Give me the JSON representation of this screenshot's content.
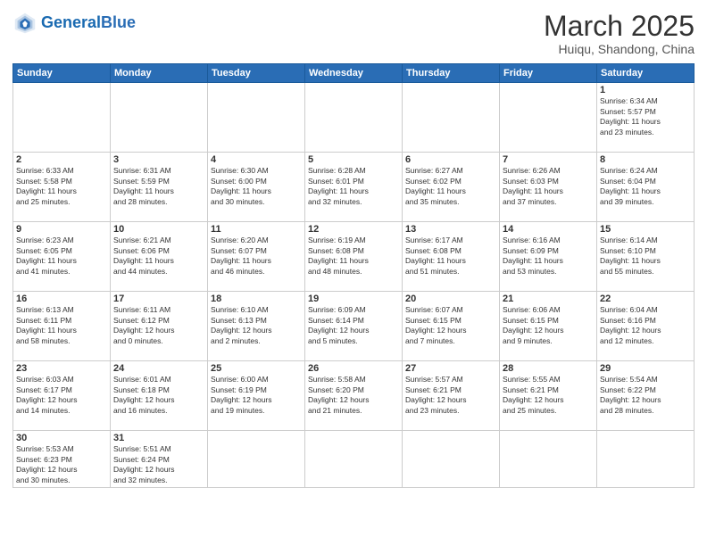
{
  "header": {
    "logo_general": "General",
    "logo_blue": "Blue",
    "month_title": "March 2025",
    "subtitle": "Huiqu, Shandong, China"
  },
  "days_of_week": [
    "Sunday",
    "Monday",
    "Tuesday",
    "Wednesday",
    "Thursday",
    "Friday",
    "Saturday"
  ],
  "weeks": [
    [
      {
        "num": "",
        "info": ""
      },
      {
        "num": "",
        "info": ""
      },
      {
        "num": "",
        "info": ""
      },
      {
        "num": "",
        "info": ""
      },
      {
        "num": "",
        "info": ""
      },
      {
        "num": "",
        "info": ""
      },
      {
        "num": "1",
        "info": "Sunrise: 6:34 AM\nSunset: 5:57 PM\nDaylight: 11 hours\nand 23 minutes."
      }
    ],
    [
      {
        "num": "2",
        "info": "Sunrise: 6:33 AM\nSunset: 5:58 PM\nDaylight: 11 hours\nand 25 minutes."
      },
      {
        "num": "3",
        "info": "Sunrise: 6:31 AM\nSunset: 5:59 PM\nDaylight: 11 hours\nand 28 minutes."
      },
      {
        "num": "4",
        "info": "Sunrise: 6:30 AM\nSunset: 6:00 PM\nDaylight: 11 hours\nand 30 minutes."
      },
      {
        "num": "5",
        "info": "Sunrise: 6:28 AM\nSunset: 6:01 PM\nDaylight: 11 hours\nand 32 minutes."
      },
      {
        "num": "6",
        "info": "Sunrise: 6:27 AM\nSunset: 6:02 PM\nDaylight: 11 hours\nand 35 minutes."
      },
      {
        "num": "7",
        "info": "Sunrise: 6:26 AM\nSunset: 6:03 PM\nDaylight: 11 hours\nand 37 minutes."
      },
      {
        "num": "8",
        "info": "Sunrise: 6:24 AM\nSunset: 6:04 PM\nDaylight: 11 hours\nand 39 minutes."
      }
    ],
    [
      {
        "num": "9",
        "info": "Sunrise: 6:23 AM\nSunset: 6:05 PM\nDaylight: 11 hours\nand 41 minutes."
      },
      {
        "num": "10",
        "info": "Sunrise: 6:21 AM\nSunset: 6:06 PM\nDaylight: 11 hours\nand 44 minutes."
      },
      {
        "num": "11",
        "info": "Sunrise: 6:20 AM\nSunset: 6:07 PM\nDaylight: 11 hours\nand 46 minutes."
      },
      {
        "num": "12",
        "info": "Sunrise: 6:19 AM\nSunset: 6:08 PM\nDaylight: 11 hours\nand 48 minutes."
      },
      {
        "num": "13",
        "info": "Sunrise: 6:17 AM\nSunset: 6:08 PM\nDaylight: 11 hours\nand 51 minutes."
      },
      {
        "num": "14",
        "info": "Sunrise: 6:16 AM\nSunset: 6:09 PM\nDaylight: 11 hours\nand 53 minutes."
      },
      {
        "num": "15",
        "info": "Sunrise: 6:14 AM\nSunset: 6:10 PM\nDaylight: 11 hours\nand 55 minutes."
      }
    ],
    [
      {
        "num": "16",
        "info": "Sunrise: 6:13 AM\nSunset: 6:11 PM\nDaylight: 11 hours\nand 58 minutes."
      },
      {
        "num": "17",
        "info": "Sunrise: 6:11 AM\nSunset: 6:12 PM\nDaylight: 12 hours\nand 0 minutes."
      },
      {
        "num": "18",
        "info": "Sunrise: 6:10 AM\nSunset: 6:13 PM\nDaylight: 12 hours\nand 2 minutes."
      },
      {
        "num": "19",
        "info": "Sunrise: 6:09 AM\nSunset: 6:14 PM\nDaylight: 12 hours\nand 5 minutes."
      },
      {
        "num": "20",
        "info": "Sunrise: 6:07 AM\nSunset: 6:15 PM\nDaylight: 12 hours\nand 7 minutes."
      },
      {
        "num": "21",
        "info": "Sunrise: 6:06 AM\nSunset: 6:15 PM\nDaylight: 12 hours\nand 9 minutes."
      },
      {
        "num": "22",
        "info": "Sunrise: 6:04 AM\nSunset: 6:16 PM\nDaylight: 12 hours\nand 12 minutes."
      }
    ],
    [
      {
        "num": "23",
        "info": "Sunrise: 6:03 AM\nSunset: 6:17 PM\nDaylight: 12 hours\nand 14 minutes."
      },
      {
        "num": "24",
        "info": "Sunrise: 6:01 AM\nSunset: 6:18 PM\nDaylight: 12 hours\nand 16 minutes."
      },
      {
        "num": "25",
        "info": "Sunrise: 6:00 AM\nSunset: 6:19 PM\nDaylight: 12 hours\nand 19 minutes."
      },
      {
        "num": "26",
        "info": "Sunrise: 5:58 AM\nSunset: 6:20 PM\nDaylight: 12 hours\nand 21 minutes."
      },
      {
        "num": "27",
        "info": "Sunrise: 5:57 AM\nSunset: 6:21 PM\nDaylight: 12 hours\nand 23 minutes."
      },
      {
        "num": "28",
        "info": "Sunrise: 5:55 AM\nSunset: 6:21 PM\nDaylight: 12 hours\nand 25 minutes."
      },
      {
        "num": "29",
        "info": "Sunrise: 5:54 AM\nSunset: 6:22 PM\nDaylight: 12 hours\nand 28 minutes."
      }
    ],
    [
      {
        "num": "30",
        "info": "Sunrise: 5:53 AM\nSunset: 6:23 PM\nDaylight: 12 hours\nand 30 minutes."
      },
      {
        "num": "31",
        "info": "Sunrise: 5:51 AM\nSunset: 6:24 PM\nDaylight: 12 hours\nand 32 minutes."
      },
      {
        "num": "",
        "info": ""
      },
      {
        "num": "",
        "info": ""
      },
      {
        "num": "",
        "info": ""
      },
      {
        "num": "",
        "info": ""
      },
      {
        "num": "",
        "info": ""
      }
    ]
  ]
}
